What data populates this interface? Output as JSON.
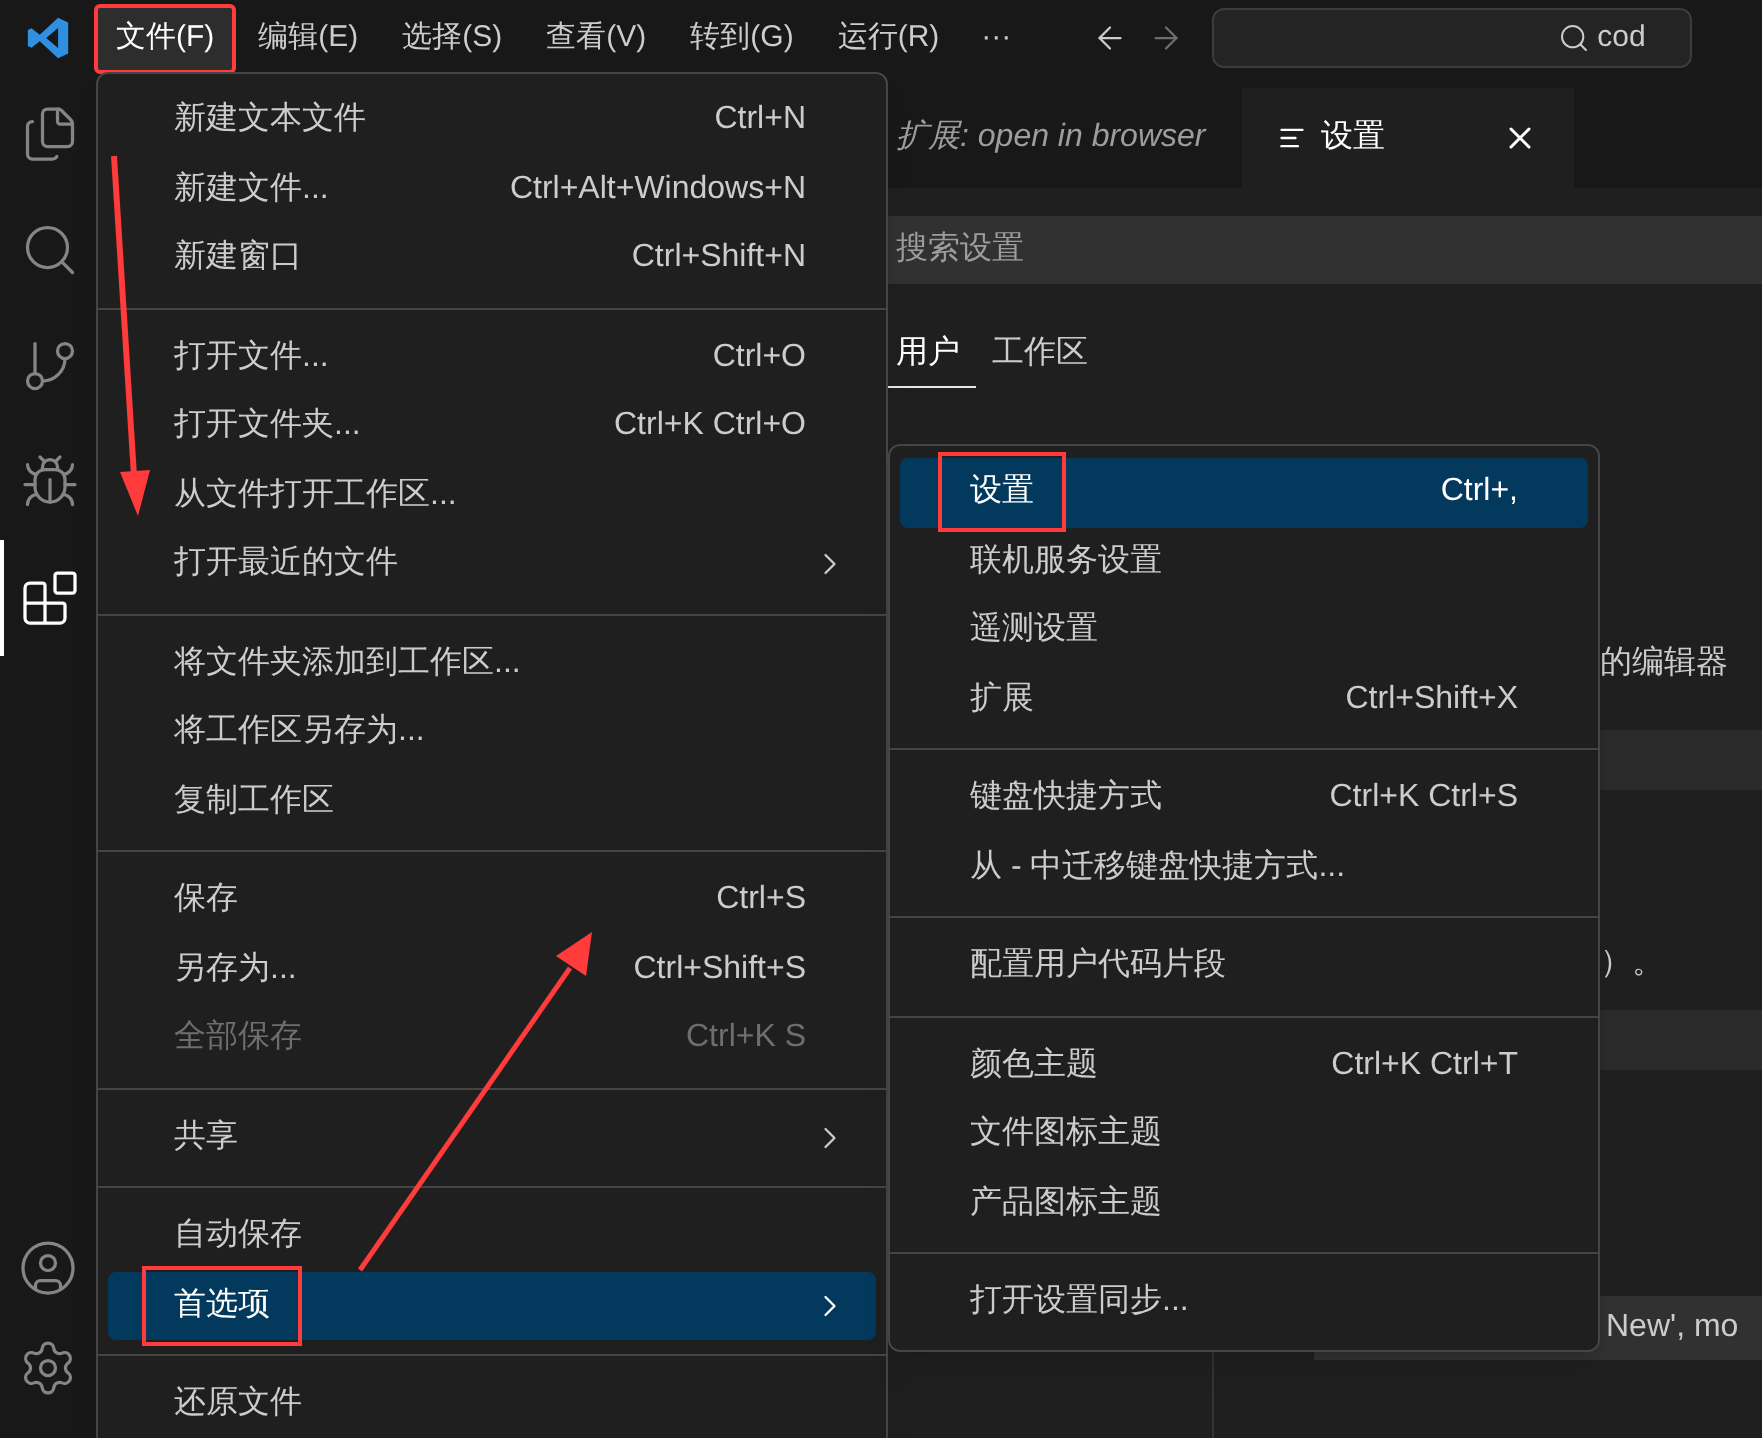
{
  "menubar": {
    "items": [
      {
        "label": "文件(F)",
        "annotated": true,
        "selected": true
      },
      {
        "label": "编辑(E)",
        "annotated": false,
        "selected": false
      },
      {
        "label": "选择(S)",
        "annotated": false,
        "selected": false
      },
      {
        "label": "查看(V)",
        "annotated": false,
        "selected": false
      },
      {
        "label": "转到(G)",
        "annotated": false,
        "selected": false
      },
      {
        "label": "运行(R)",
        "annotated": false,
        "selected": false
      }
    ],
    "more": "···"
  },
  "command_center": {
    "value": "cod"
  },
  "activity_bar": [
    {
      "kind": "files",
      "selected": false
    },
    {
      "kind": "search",
      "selected": false
    },
    {
      "kind": "source-control",
      "selected": false
    },
    {
      "kind": "run",
      "selected": false
    },
    {
      "kind": "extensions",
      "selected": true
    }
  ],
  "activity_bar_bottom": [
    {
      "kind": "account"
    },
    {
      "kind": "manage"
    }
  ],
  "editor_tabs": [
    {
      "label": "扩展: open in browser",
      "preview": true,
      "selected": false
    },
    {
      "label": "设置",
      "preview": false,
      "selected": true
    }
  ],
  "settings": {
    "search": {
      "placeholder": "搜索设置"
    },
    "scope_tabs": [
      {
        "label": "用户",
        "selected": true
      },
      {
        "label": "工作区",
        "selected": false
      }
    ],
    "fragments": [
      "的编辑器",
      "）。",
      "New', mo"
    ]
  },
  "file_menu": [
    {
      "kind": "item",
      "label": "新建文本文件",
      "shortcut": "Ctrl+N",
      "submenu": false,
      "disabled": false,
      "selected": false,
      "annotated": false
    },
    {
      "kind": "item",
      "label": "新建文件...",
      "shortcut": "Ctrl+Alt+Windows+N",
      "submenu": false,
      "disabled": false,
      "selected": false,
      "annotated": false
    },
    {
      "kind": "item",
      "label": "新建窗口",
      "shortcut": "Ctrl+Shift+N",
      "submenu": false,
      "disabled": false,
      "selected": false,
      "annotated": false
    },
    {
      "kind": "separator"
    },
    {
      "kind": "item",
      "label": "打开文件...",
      "shortcut": "Ctrl+O",
      "submenu": false,
      "disabled": false,
      "selected": false,
      "annotated": false
    },
    {
      "kind": "item",
      "label": "打开文件夹...",
      "shortcut": "Ctrl+K Ctrl+O",
      "submenu": false,
      "disabled": false,
      "selected": false,
      "annotated": false
    },
    {
      "kind": "item",
      "label": "从文件打开工作区...",
      "submenu": false,
      "disabled": false,
      "selected": false,
      "annotated": false
    },
    {
      "kind": "item",
      "label": "打开最近的文件",
      "submenu": true,
      "disabled": false,
      "selected": false,
      "annotated": false
    },
    {
      "kind": "separator"
    },
    {
      "kind": "item",
      "label": "将文件夹添加到工作区...",
      "submenu": false,
      "disabled": false,
      "selected": false,
      "annotated": false
    },
    {
      "kind": "item",
      "label": "将工作区另存为...",
      "submenu": false,
      "disabled": false,
      "selected": false,
      "annotated": false
    },
    {
      "kind": "item",
      "label": "复制工作区",
      "submenu": false,
      "disabled": false,
      "selected": false,
      "annotated": false
    },
    {
      "kind": "separator"
    },
    {
      "kind": "item",
      "label": "保存",
      "shortcut": "Ctrl+S",
      "submenu": false,
      "disabled": false,
      "selected": false,
      "annotated": false
    },
    {
      "kind": "item",
      "label": "另存为...",
      "shortcut": "Ctrl+Shift+S",
      "submenu": false,
      "disabled": false,
      "selected": false,
      "annotated": false
    },
    {
      "kind": "item",
      "label": "全部保存",
      "shortcut": "Ctrl+K S",
      "submenu": false,
      "disabled": true,
      "selected": false,
      "annotated": false
    },
    {
      "kind": "separator"
    },
    {
      "kind": "item",
      "label": "共享",
      "submenu": true,
      "disabled": false,
      "selected": false,
      "annotated": false
    },
    {
      "kind": "separator"
    },
    {
      "kind": "item",
      "label": "自动保存",
      "submenu": false,
      "disabled": false,
      "selected": false,
      "annotated": false
    },
    {
      "kind": "item",
      "label": "首选项",
      "submenu": true,
      "disabled": false,
      "selected": true,
      "annotated": true
    },
    {
      "kind": "separator"
    },
    {
      "kind": "item",
      "label": "还原文件",
      "submenu": false,
      "disabled": false,
      "selected": false,
      "annotated": false
    }
  ],
  "preferences_menu": [
    {
      "kind": "item",
      "label": "设置",
      "shortcut": "Ctrl+,",
      "selected": true,
      "annotated": true
    },
    {
      "kind": "item",
      "label": "联机服务设置",
      "selected": false,
      "annotated": false
    },
    {
      "kind": "item",
      "label": "遥测设置",
      "selected": false,
      "annotated": false
    },
    {
      "kind": "item",
      "label": "扩展",
      "shortcut": "Ctrl+Shift+X",
      "selected": false,
      "annotated": false
    },
    {
      "kind": "separator"
    },
    {
      "kind": "item",
      "label": "键盘快捷方式",
      "shortcut": "Ctrl+K Ctrl+S",
      "selected": false,
      "annotated": false
    },
    {
      "kind": "item",
      "label": "从 - 中迁移键盘快捷方式...",
      "selected": false,
      "annotated": false
    },
    {
      "kind": "separator"
    },
    {
      "kind": "item",
      "label": "配置用户代码片段",
      "selected": false,
      "annotated": false
    },
    {
      "kind": "separator"
    },
    {
      "kind": "item",
      "label": "颜色主题",
      "shortcut": "Ctrl+K Ctrl+T",
      "selected": false,
      "annotated": false
    },
    {
      "kind": "item",
      "label": "文件图标主题",
      "selected": false,
      "annotated": false
    },
    {
      "kind": "item",
      "label": "产品图标主题",
      "selected": false,
      "annotated": false
    },
    {
      "kind": "separator"
    },
    {
      "kind": "item",
      "label": "打开设置同步...",
      "selected": false,
      "annotated": false
    }
  ]
}
